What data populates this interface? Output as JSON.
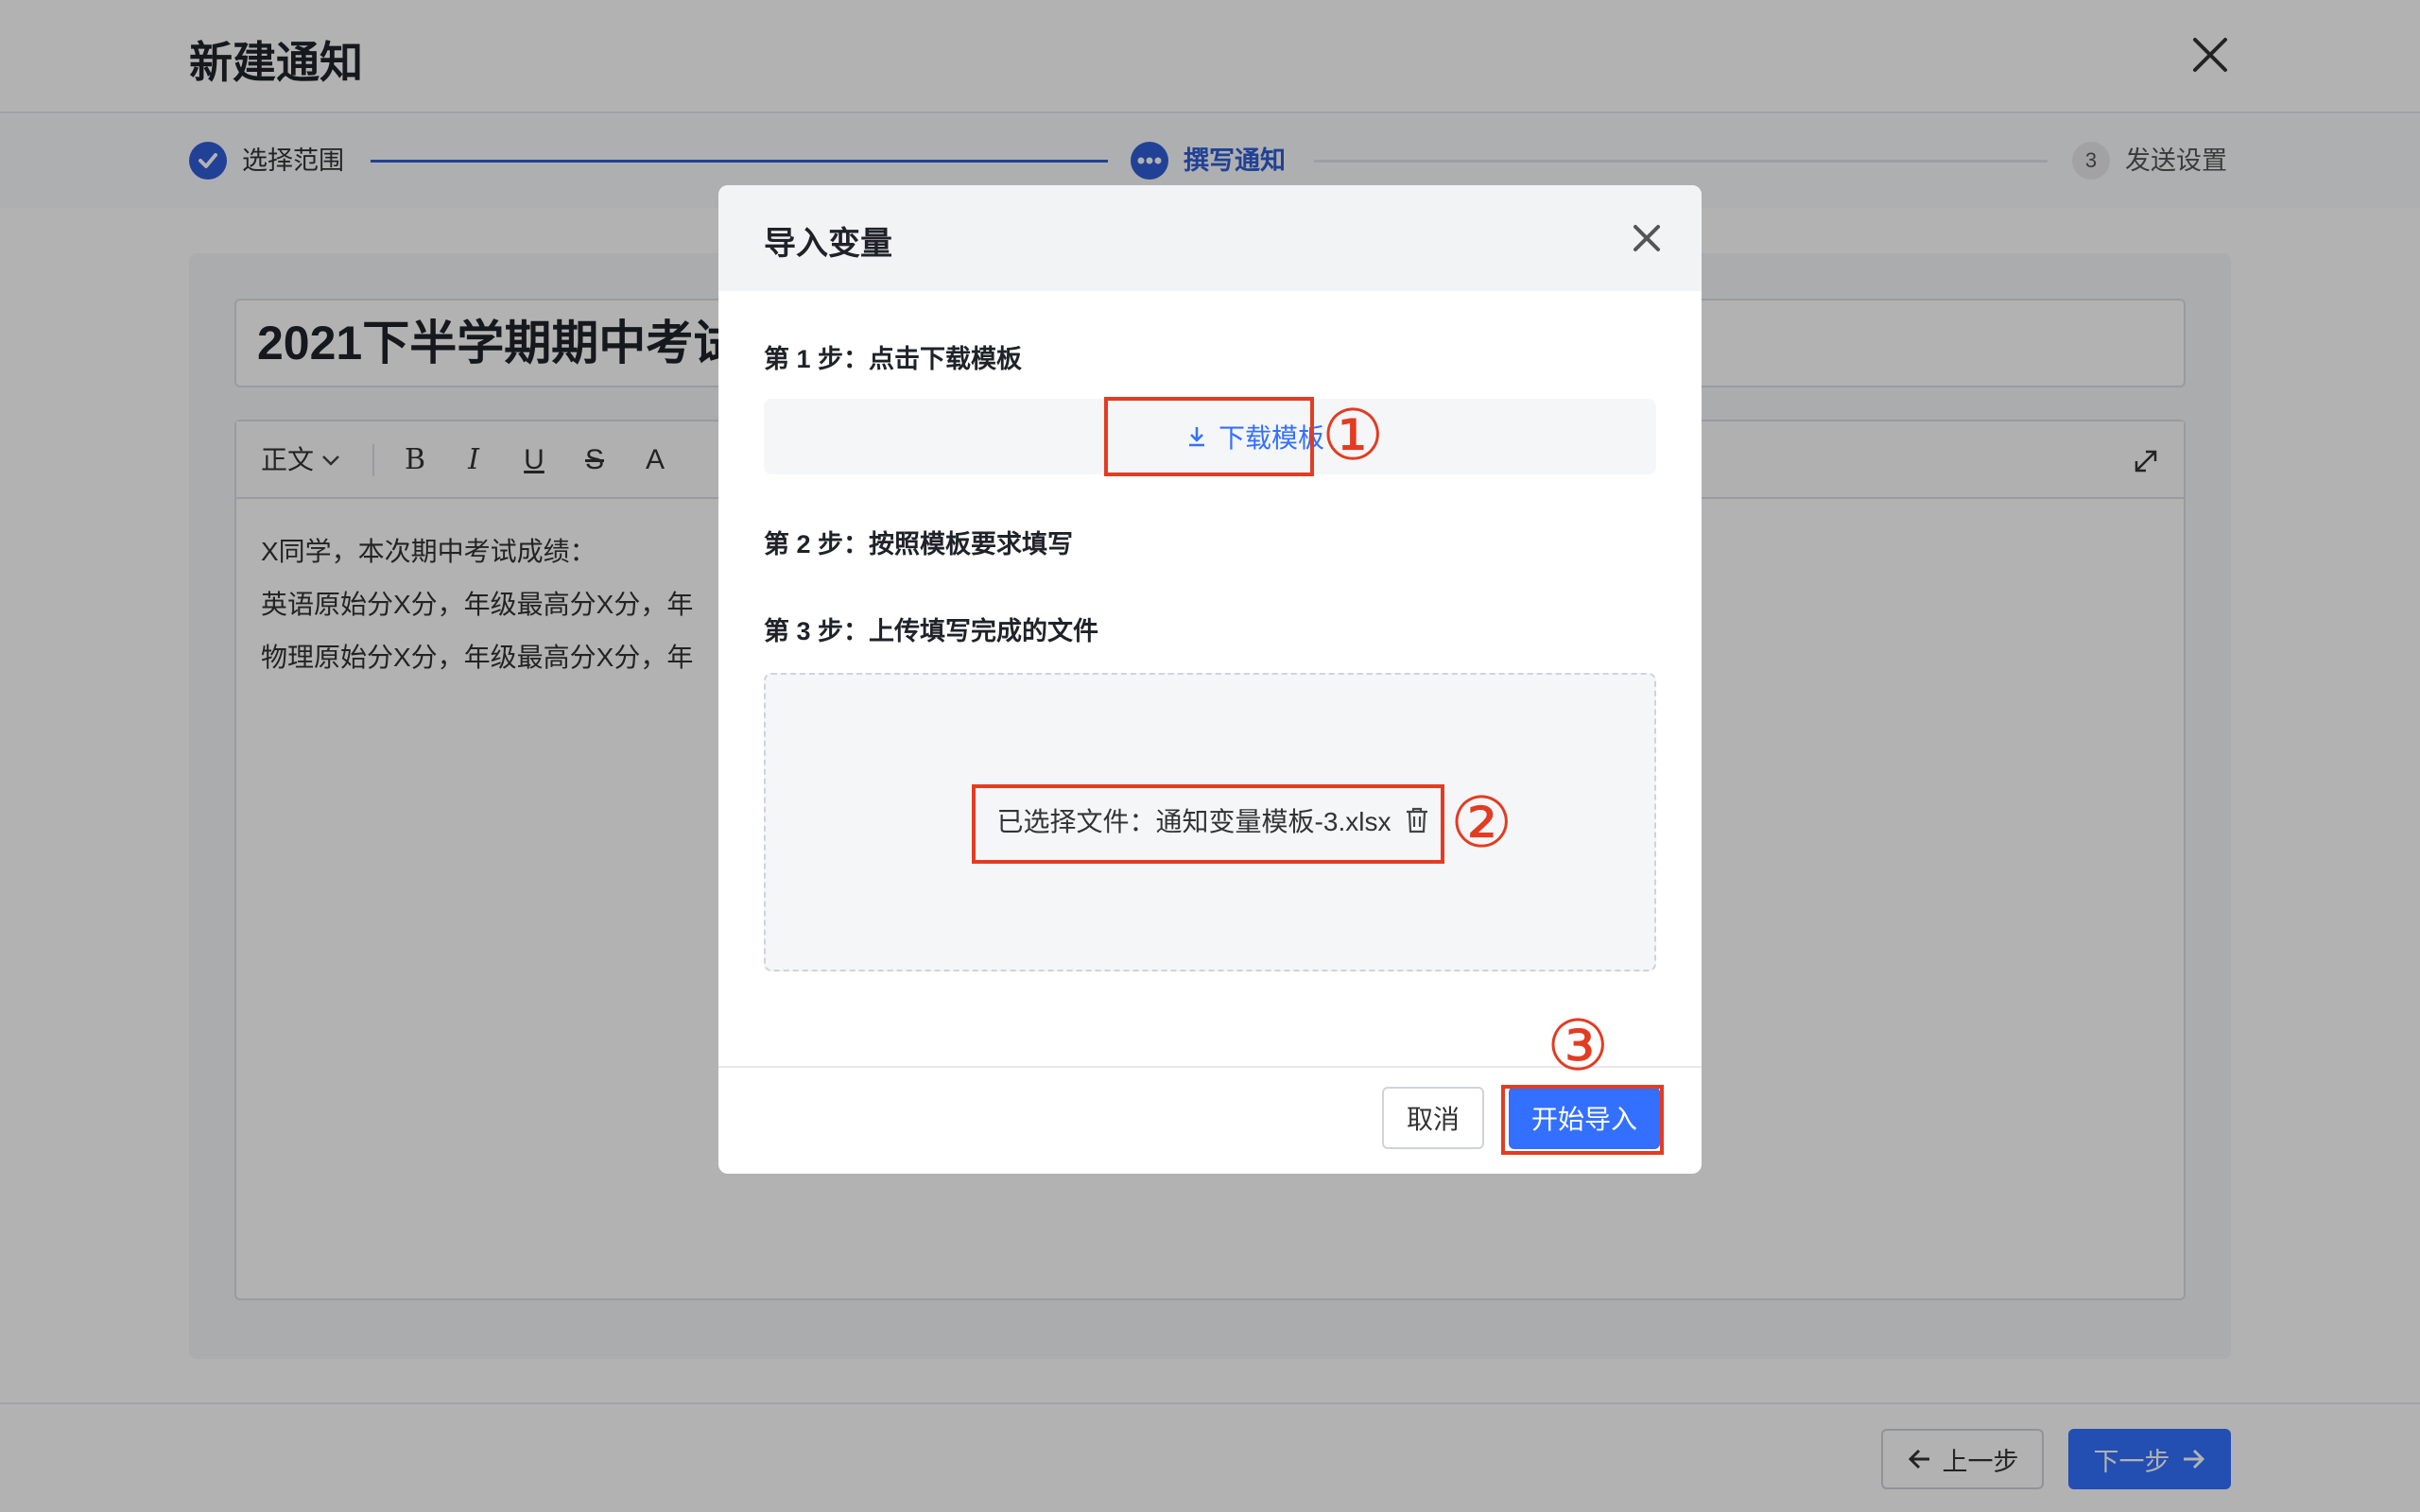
{
  "page": {
    "title": "新建通知"
  },
  "steps": [
    {
      "label": "选择范围",
      "state": "done"
    },
    {
      "label": "撰写通知",
      "state": "active"
    },
    {
      "label": "发送设置",
      "state": "pending",
      "number": "3"
    }
  ],
  "editor": {
    "title": "2021下半学期期中考试",
    "format": "正文",
    "toolbar": {
      "bold": "B",
      "italic": "I",
      "underline": "U",
      "strike": "S",
      "color": "A"
    },
    "lines": [
      "X同学，本次期中考试成绩：",
      "英语原始分X分，年级最高分X分，年",
      "物理原始分X分，年级最高分X分，年"
    ]
  },
  "footer": {
    "prev_label": "上一步",
    "next_label": "下一步"
  },
  "modal": {
    "title": "导入变量",
    "step1": "第 1 步：点击下载模板",
    "download_label": "下载模板",
    "step2": "第 2 步：按照模板要求填写",
    "step3": "第 3 步：上传填写完成的文件",
    "selected_file": "已选择文件：通知变量模板-3.xlsx",
    "cancel_label": "取消",
    "import_label": "开始导入"
  },
  "annotations": [
    "①",
    "②",
    "③"
  ],
  "colors": {
    "primary": "#3370ff",
    "step_done": "#2f5dd6",
    "annotation": "#e23c22"
  },
  "icons": {
    "close": "close-icon",
    "check": "check-icon",
    "more": "more-icon",
    "download": "download-icon",
    "trash": "trash-icon",
    "expand": "expand-icon",
    "arrow_left": "arrow-left-icon",
    "arrow_right": "arrow-right-icon",
    "chevron_down": "chevron-down-icon"
  }
}
